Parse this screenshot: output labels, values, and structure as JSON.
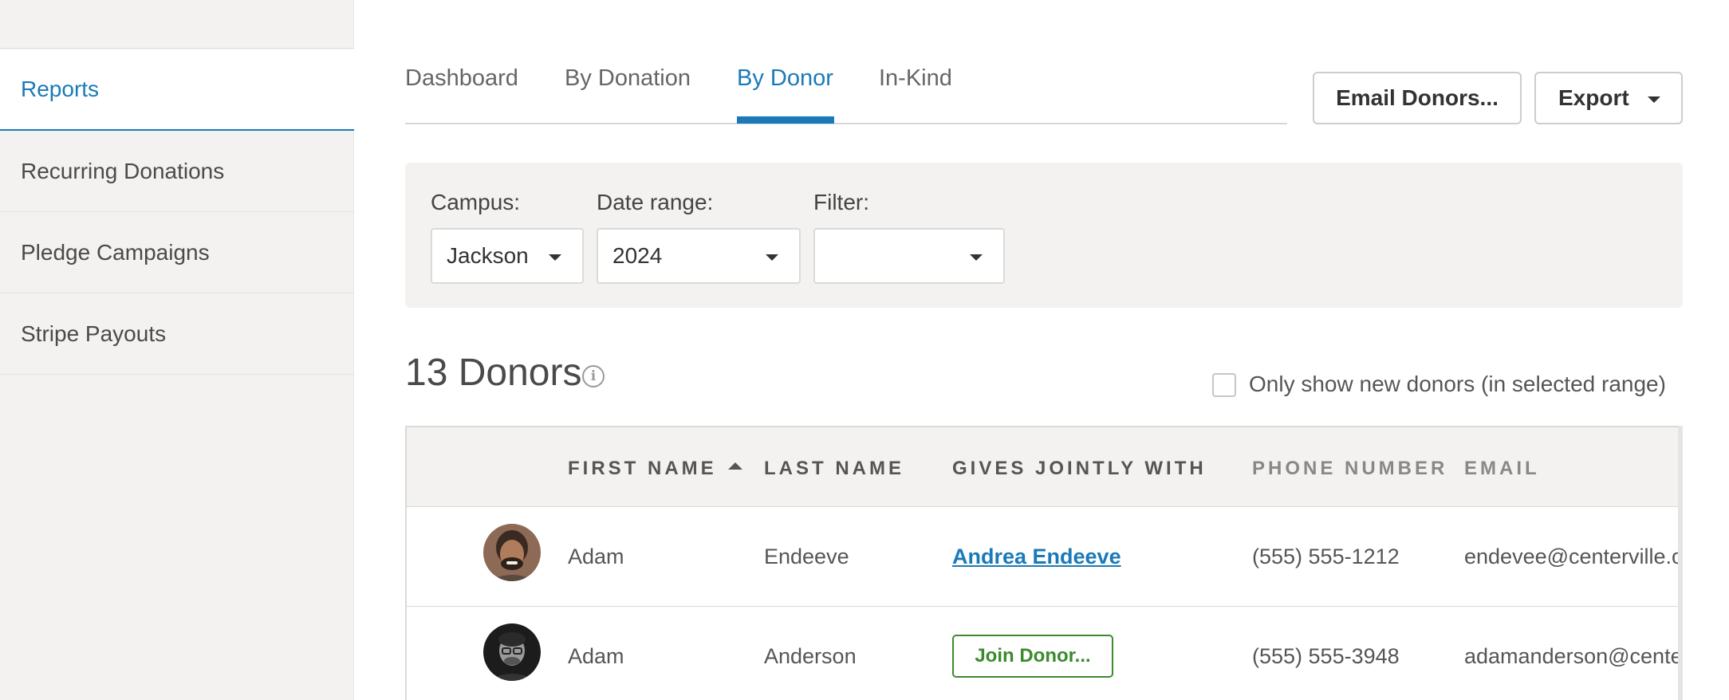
{
  "sidebar": {
    "items": [
      {
        "label": "Reports"
      },
      {
        "label": "Recurring Donations"
      },
      {
        "label": "Pledge Campaigns"
      },
      {
        "label": "Stripe Payouts"
      }
    ]
  },
  "tabs": [
    {
      "label": "Dashboard"
    },
    {
      "label": "By Donation"
    },
    {
      "label": "By Donor"
    },
    {
      "label": "In-Kind"
    }
  ],
  "toolbar": {
    "email_label": "Email Donors...",
    "export_label": "Export"
  },
  "filters": {
    "campus_label": "Campus:",
    "campus_value": "Jackson",
    "date_label": "Date range:",
    "date_value": "2024",
    "filter_label": "Filter:",
    "filter_value": ""
  },
  "donors": {
    "count_text": "13 Donors",
    "new_only_label": "Only show new donors (in selected range)"
  },
  "table": {
    "headers": {
      "first_name": "FIRST NAME",
      "last_name": "LAST NAME",
      "gives_jointly": "GIVES JOINTLY WITH",
      "phone": "PHONE NUMBER",
      "email": "EMAIL"
    },
    "rows": [
      {
        "first": "Adam",
        "last": "Endeeve",
        "joint": "Andrea Endeeve",
        "joint_type": "link",
        "phone": "(555) 555-1212",
        "email": "endevee@centerville.org"
      },
      {
        "first": "Adam",
        "last": "Anderson",
        "joint": "Join Donor...",
        "joint_type": "button",
        "phone": "(555) 555-3948",
        "email": "adamanderson@centerville.org"
      }
    ]
  },
  "colors": {
    "accent": "#1a7ab8",
    "join_green": "#3c8a2e",
    "panel_bg": "#f3f2f1"
  }
}
